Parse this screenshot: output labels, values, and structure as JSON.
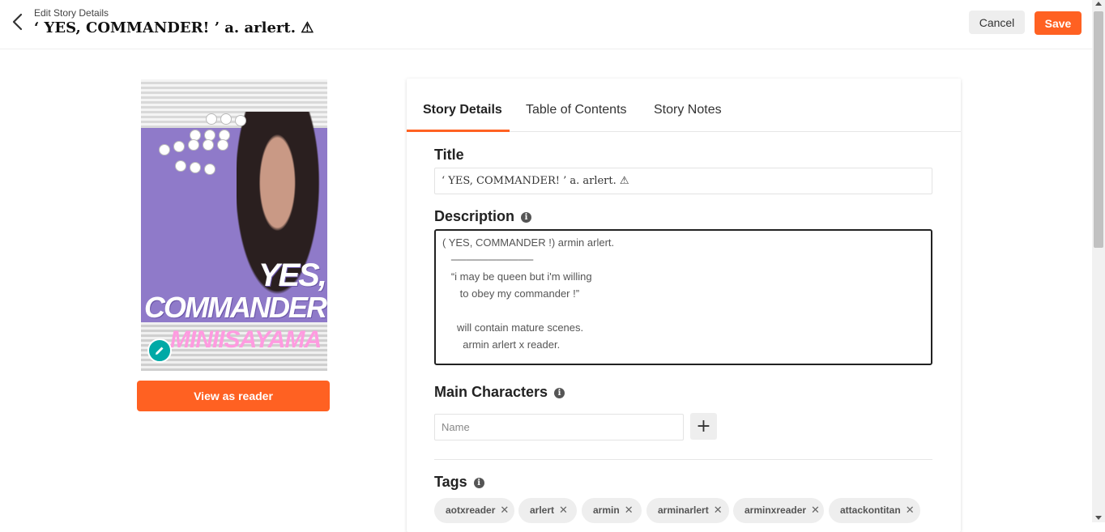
{
  "header": {
    "breadcrumb": "Edit Story Details",
    "title": "‘ YES, COMMANDER! ’ a. arlert. ⚠",
    "cancel_label": "Cancel",
    "save_label": "Save"
  },
  "cover": {
    "line1": "YES,",
    "line2": "COMMANDER",
    "line3": "MINIISAYAMA",
    "view_as_reader_label": "View as reader"
  },
  "tabs": [
    {
      "label": "Story Details",
      "active": true
    },
    {
      "label": "Table of Contents",
      "active": false
    },
    {
      "label": "Story Notes",
      "active": false
    }
  ],
  "form": {
    "title_label": "Title",
    "title_value": "‘ YES, COMMANDER! ’ a. arlert. ⚠",
    "description_label": "Description",
    "description_value": "( YES, COMMANDER !) armin arlert.\n   ───────────\n   “i may be queen but i'm willing\n      to obey my commander !”\n\n     will contain mature scenes.\n       armin arlert x reader.",
    "main_characters_label": "Main Characters",
    "name_placeholder": "Name",
    "add_label": "+",
    "tags_label": "Tags",
    "tags": [
      "aotxreader",
      "arlert",
      "armin",
      "arminarlert",
      "arminxreader",
      "attackontitan"
    ]
  },
  "colors": {
    "accent": "#ff6122",
    "edit_badge": "#00a9a6"
  }
}
